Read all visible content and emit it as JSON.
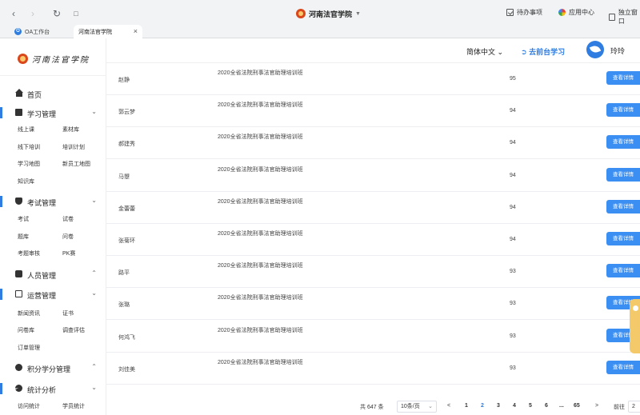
{
  "browser": {
    "site_title": "河南法官学院",
    "right_items": [
      {
        "label": "待办事项",
        "icon": "todo-icon"
      },
      {
        "label": "应用中心",
        "icon": "app-center-icon"
      },
      {
        "label": "独立窗口",
        "icon": "window-icon"
      }
    ],
    "tabs": [
      {
        "label": "OA工作台",
        "active": false,
        "icon_letter": "O"
      },
      {
        "label": "河南法官学院",
        "active": true
      }
    ]
  },
  "sidebar": {
    "brand": "河南法官学院",
    "home": "首页",
    "groups": [
      {
        "label": "学习管理",
        "items": [
          "线上课",
          "素材库",
          "线下培训",
          "培训计划",
          "学习地图",
          "新员工地图",
          "知识库"
        ]
      },
      {
        "label": "考试管理",
        "items": [
          "考试",
          "试卷",
          "题库",
          "问卷",
          "考题审核",
          "PK赛"
        ]
      },
      {
        "label": "人员管理",
        "items": []
      },
      {
        "label": "运营管理",
        "items": [
          "新闻资讯",
          "证书",
          "问卷库",
          "调查评估",
          "订单管理"
        ]
      },
      {
        "label": "积分学分管理",
        "items": []
      },
      {
        "label": "统计分析",
        "items": [
          "访问统计",
          "学员统计"
        ]
      }
    ]
  },
  "topbar": {
    "language": "简体中文",
    "goto_front": "去前台学习",
    "username": "玲玲"
  },
  "table": {
    "rows": [
      {
        "name": "赵静",
        "class": "2020全省法院刑事法官助理培训班",
        "score": "95",
        "action": "查看详情"
      },
      {
        "name": "郭云梦",
        "class": "2020全省法院刑事法官助理培训班",
        "score": "94",
        "action": "查看详情"
      },
      {
        "name": "郝建秀",
        "class": "2020全省法院刑事法官助理培训班",
        "score": "94",
        "action": "查看详情"
      },
      {
        "name": "马曌",
        "class": "2020全省法院刑事法官助理培训班",
        "score": "94",
        "action": "查看详情"
      },
      {
        "name": "金蕾蕾",
        "class": "2020全省法院刑事法官助理培训班",
        "score": "94",
        "action": "查看详情"
      },
      {
        "name": "张菊环",
        "class": "2020全省法院刑事法官助理培训班",
        "score": "94",
        "action": "查看详情"
      },
      {
        "name": "路平",
        "class": "2020全省法院刑事法官助理培训班",
        "score": "93",
        "action": "查看详情"
      },
      {
        "name": "张璐",
        "class": "2020全省法院刑事法官助理培训班",
        "score": "93",
        "action": "查看详情"
      },
      {
        "name": "何鸿飞",
        "class": "2020全省法院刑事法官助理培训班",
        "score": "93",
        "action": "查看详情"
      },
      {
        "name": "刘佳美",
        "class": "2020全省法院刑事法官助理培训班",
        "score": "93",
        "action": "查看详情"
      }
    ]
  },
  "pagination": {
    "total": "共 647 条",
    "page_size": "10条/页",
    "prev": "<",
    "pages": [
      "1",
      "2",
      "3",
      "4",
      "5",
      "6",
      "...",
      "65"
    ],
    "current": "2",
    "next": ">",
    "goto_label": "前往",
    "goto_value": "2"
  }
}
